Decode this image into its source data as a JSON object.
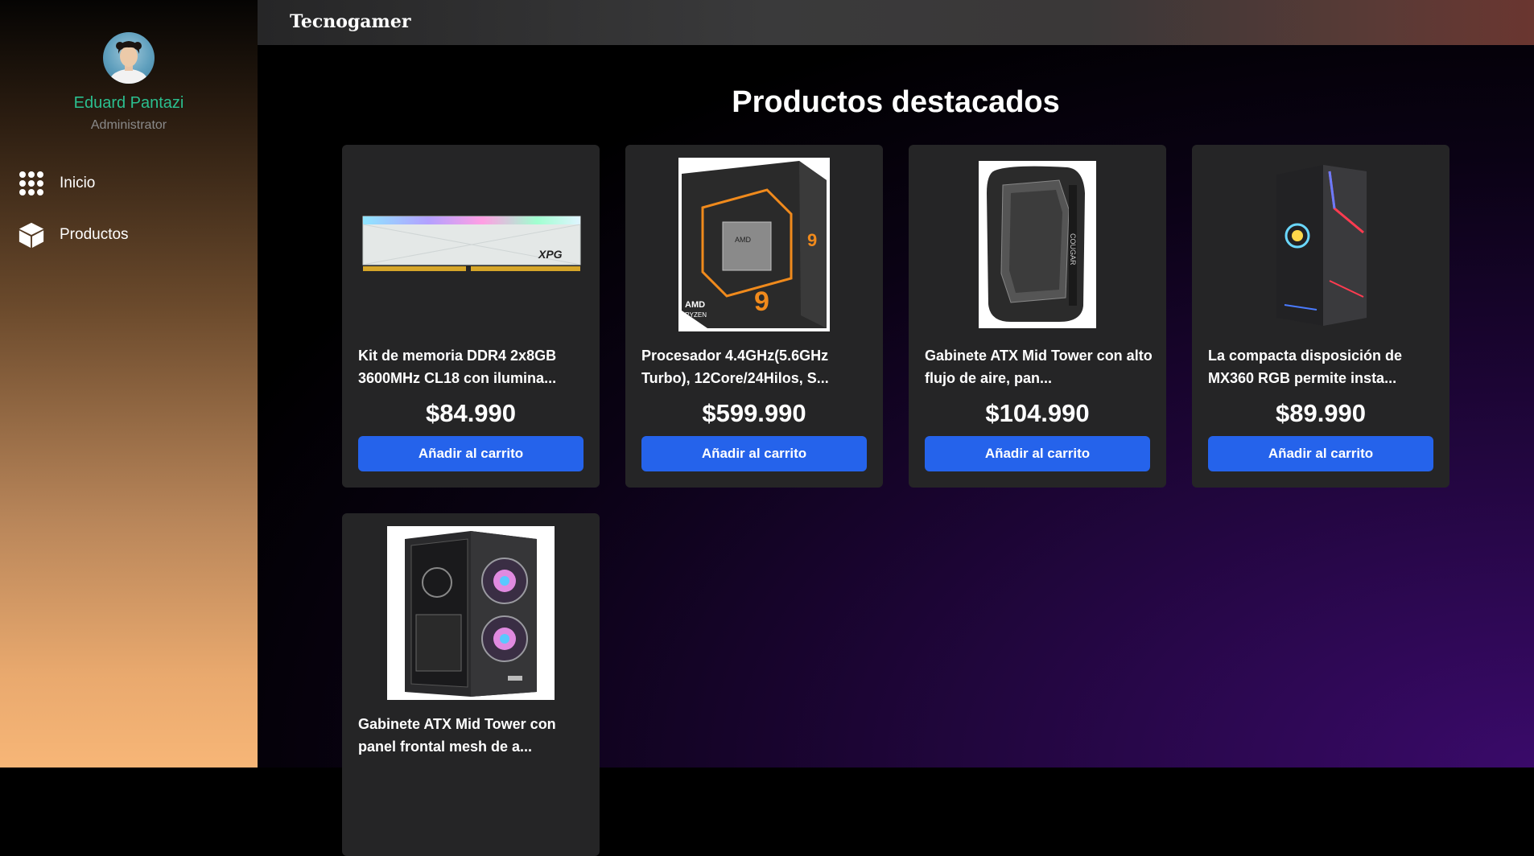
{
  "sidebar": {
    "user_name": "Eduard Pantazi",
    "user_role": "Administrator",
    "items": [
      {
        "label": "Inicio",
        "icon": "grid-dots-icon"
      },
      {
        "label": "Productos",
        "icon": "box-icon"
      }
    ]
  },
  "header": {
    "brand": "Tecnogamer"
  },
  "main": {
    "title": "Productos destacados",
    "products": [
      {
        "name": "Kit de memoria DDR4 2x8GB 3600MHz CL18 con ilumina...",
        "price": "$84.990",
        "button": "Añadir al carrito",
        "image": "ram-module-image"
      },
      {
        "name": "Procesador 4.4GHz(5.6GHz Turbo), 12Core/24Hilos, S...",
        "price": "$599.990",
        "button": "Añadir al carrito",
        "image": "cpu-box-image"
      },
      {
        "name": "Gabinete ATX Mid Tower con alto flujo de aire, pan...",
        "price": "$104.990",
        "button": "Añadir al carrito",
        "image": "pc-case-image"
      },
      {
        "name": "La compacta disposición de MX360 RGB permite insta...",
        "price": "$89.990",
        "button": "Añadir al carrito",
        "image": "rgb-case-image"
      },
      {
        "name": "Gabinete ATX Mid Tower con panel frontal mesh de a...",
        "price": "",
        "button": "",
        "image": "mesh-case-image"
      }
    ]
  },
  "colors": {
    "accent_button": "#2563eb",
    "user_name": "#2bbf8f",
    "card_bg": "#252526"
  }
}
